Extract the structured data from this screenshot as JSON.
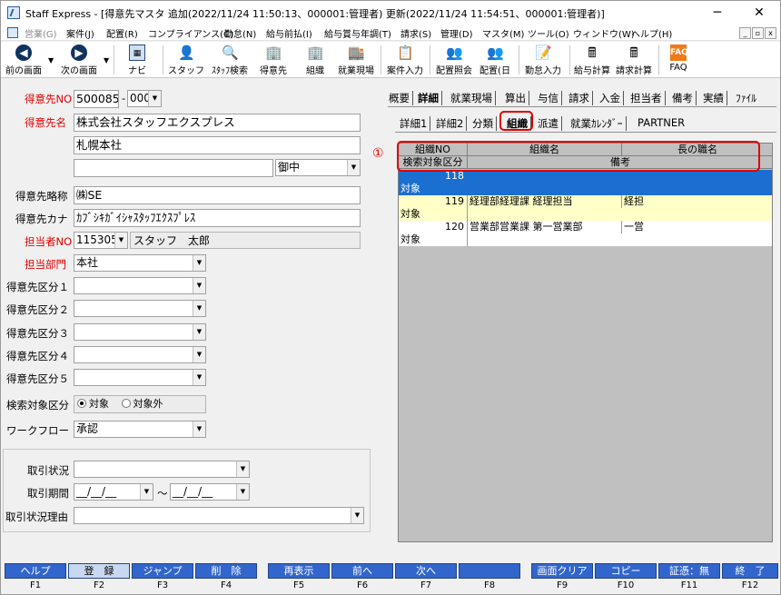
{
  "window": {
    "title": "Staff Express - [得意先マスタ 追加(2022/11/24 11:50:13、000001:管理者) 更新(2022/11/24 11:54:51、000001:管理者)]",
    "minimize": "─",
    "maximize": "☐",
    "close": "✕"
  },
  "menu": [
    "営業(G)",
    "案件(J)",
    "配置(R)",
    "コンプライアンス(C)",
    "勤怠(N)",
    "給与前払(I)",
    "給与賞与年調(T)",
    "請求(S)",
    "管理(D)",
    "マスタ(M)",
    "ツール(O)",
    "ウィンドウ(W)",
    "ヘルプ(H)"
  ],
  "mdi": {
    "minimize": "_",
    "restore": "▫",
    "close": "x"
  },
  "toolbar": {
    "prev": "前の画面",
    "next": "次の画面",
    "navi": "ナビ",
    "staff": "スタッフ",
    "staff_search": "ｽﾀｯﾌ検索",
    "client": "得意先",
    "org": "組織",
    "site": "就業現場",
    "case_entry": "案件入力",
    "assign_inquiry": "配置照会",
    "assign_day": "配置(日",
    "attendance": "勤怠入力",
    "payroll_calc": "給与計算",
    "billing_calc": "請求計算",
    "faq": "FAQ"
  },
  "form": {
    "client_no_label": "得意先NO",
    "client_no": "500085",
    "dash": "-",
    "client_sub": "000",
    "client_name_label": "得意先名",
    "client_name": "株式会社スタッフエクスプレス",
    "client_name2": "札幌本社",
    "client_name3": "",
    "honorific": "御中",
    "short_name_label": "得意先略称",
    "short_name": "㈱SE",
    "kana_label": "得意先カナ",
    "kana": "ｶﾌﾞｼｷｶﾞｲｼｬｽﾀｯﾌｴｸｽﾌﾟﾚｽ",
    "rep_no_label": "担当者NO",
    "rep_no": "115305",
    "rep_name": "スタッフ　太郎",
    "dept_label": "担当部門",
    "dept": "本社",
    "class1_label": "得意先区分１",
    "class2_label": "得意先区分２",
    "class3_label": "得意先区分３",
    "class4_label": "得意先区分４",
    "class5_label": "得意先区分５",
    "search_label": "検索対象区分",
    "search_on": "対象",
    "search_off": "対象外",
    "workflow_label": "ワークフロー",
    "workflow": "承認",
    "deal_status_label": "取引状況",
    "deal_period_label": "取引期間",
    "date_from": "__/__/__",
    "tilde": "～",
    "date_to": "__/__/__",
    "deal_reason_label": "取引状況理由"
  },
  "tabs1": [
    "概要",
    "詳細",
    "就業現場",
    "算出",
    "与信",
    "請求",
    "入金",
    "担当者",
    "備考",
    "実績",
    "ﾌｧｲﾙ"
  ],
  "tabs2": [
    "詳細1",
    "詳細2",
    "分類",
    "組織",
    "派遣",
    "就業ｶﾚﾝﾀﾞｰ",
    "PARTNER"
  ],
  "grid": {
    "headers": {
      "org_no": "組織NO",
      "org_name": "組織名",
      "head_title": "長の職名",
      "search_class": "検索対象区分",
      "remarks": "備考"
    },
    "rows": [
      {
        "no": "118",
        "name": "",
        "title": "",
        "search": "対象"
      },
      {
        "no": "119",
        "name": "経理部経理課 経理担当",
        "title": "経担",
        "search": "対象"
      },
      {
        "no": "120",
        "name": "営業部営業課 第一営業部",
        "title": "一営",
        "search": "対象"
      }
    ]
  },
  "annotation": "①",
  "fkeys": [
    {
      "label": "ヘルプ",
      "key": "F1"
    },
    {
      "label": "登　録",
      "key": "F2"
    },
    {
      "label": "ジャンプ",
      "key": "F3"
    },
    {
      "label": "削　除",
      "key": "F4"
    },
    {
      "label": "再表示",
      "key": "F5"
    },
    {
      "label": "前へ",
      "key": "F6"
    },
    {
      "label": "次へ",
      "key": "F7"
    },
    {
      "label": "",
      "key": "F8"
    },
    {
      "label": "画面クリア",
      "key": "F9"
    },
    {
      "label": "コピー",
      "key": "F10"
    },
    {
      "label": "証憑：無",
      "key": "F11"
    },
    {
      "label": "終　了",
      "key": "F12"
    }
  ],
  "colors": {
    "accent": "#3366cc",
    "required_label": "#e00000",
    "selected_row": "#1a6fd0",
    "band_row": "#ffffc8",
    "highlight": "#e00000"
  }
}
